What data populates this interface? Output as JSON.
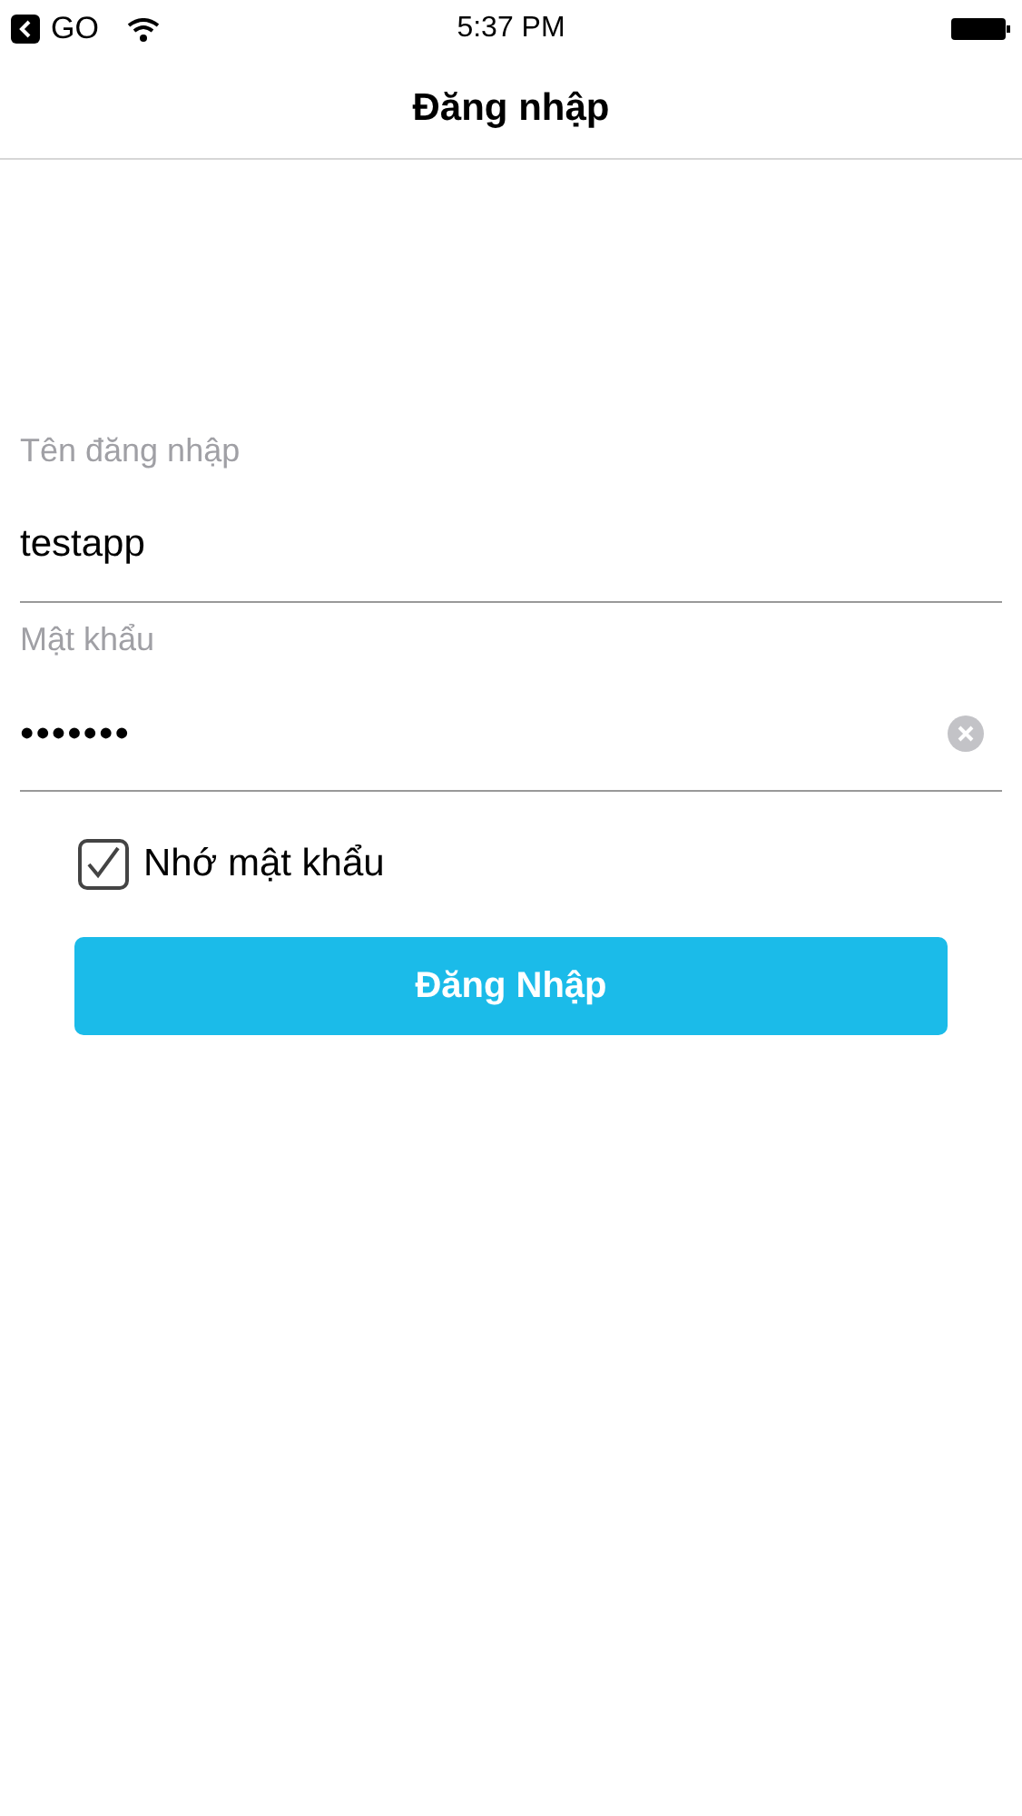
{
  "status_bar": {
    "back_label": "GO",
    "time": "5:37 PM"
  },
  "nav": {
    "title": "Đăng nhập"
  },
  "fields": [
    {
      "kind": "text",
      "label": "Tên đăng nhập",
      "value": "testapp",
      "clearable": false
    },
    {
      "kind": "password",
      "label": "Mật khẩu",
      "value": "•••••••",
      "clearable": true
    }
  ],
  "remember": {
    "label": "Nhớ mật khẩu",
    "checked": true
  },
  "submit": {
    "label": "Đăng Nhập"
  }
}
